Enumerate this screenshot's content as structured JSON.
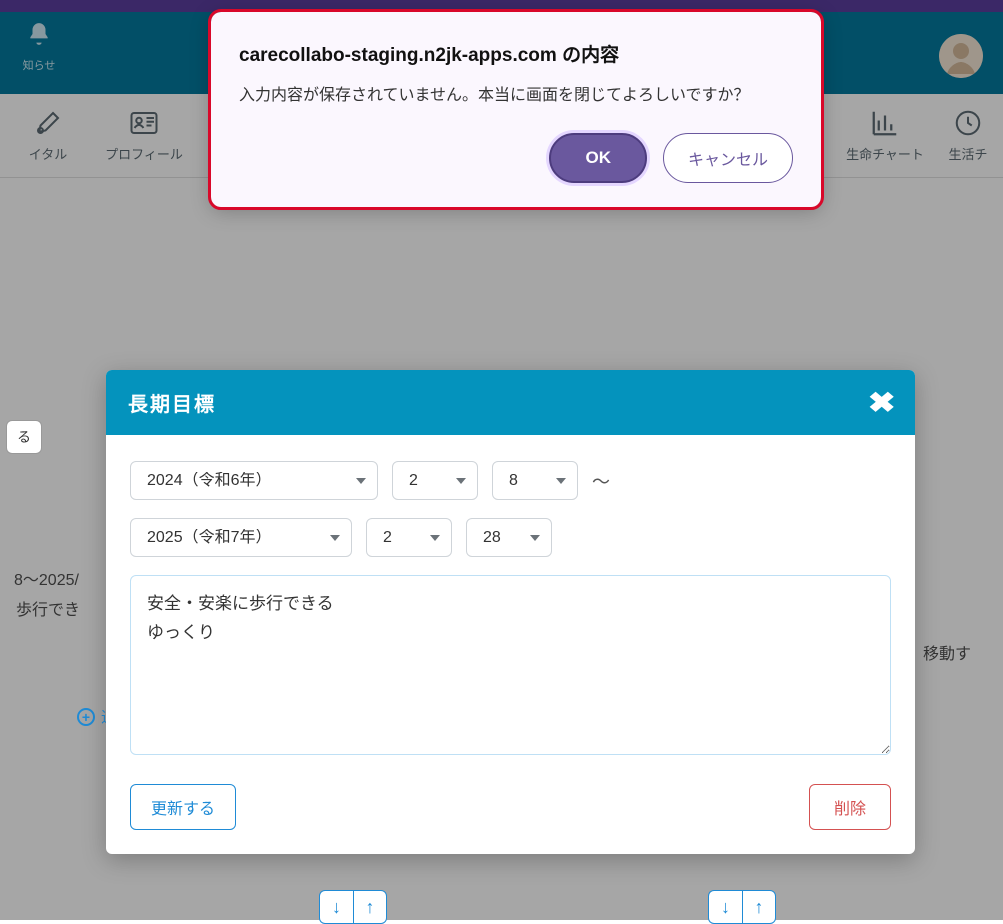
{
  "header": {
    "bell_label": "知らせ"
  },
  "tabs": {
    "vital": "イタル",
    "profile": "プロフィール",
    "life_chart": "生命チャート",
    "life_cycle": "生活チ"
  },
  "background": {
    "btn_something": "る",
    "date_range": "8～2025/",
    "walk_text": "歩行でき",
    "add_label": "追",
    "move_text": "移動す"
  },
  "modal": {
    "title": "長期目標",
    "year_start": "2024（令和6年）",
    "month_start": "2",
    "day_start": "8",
    "tilde": "～",
    "year_end": "2025（令和7年）",
    "month_end": "2",
    "day_end": "28",
    "textarea_value": "安全・安楽に歩行できる\nゆっくり",
    "update_label": "更新する",
    "delete_label": "削除"
  },
  "alert": {
    "title": "carecollabo-staging.n2jk-apps.com の内容",
    "message": "入力内容が保存されていません。本当に画面を閉じてよろしいですか？",
    "ok_label": "OK",
    "cancel_label": "キャンセル"
  },
  "arrows": {
    "down": "↓",
    "up": "↑"
  }
}
